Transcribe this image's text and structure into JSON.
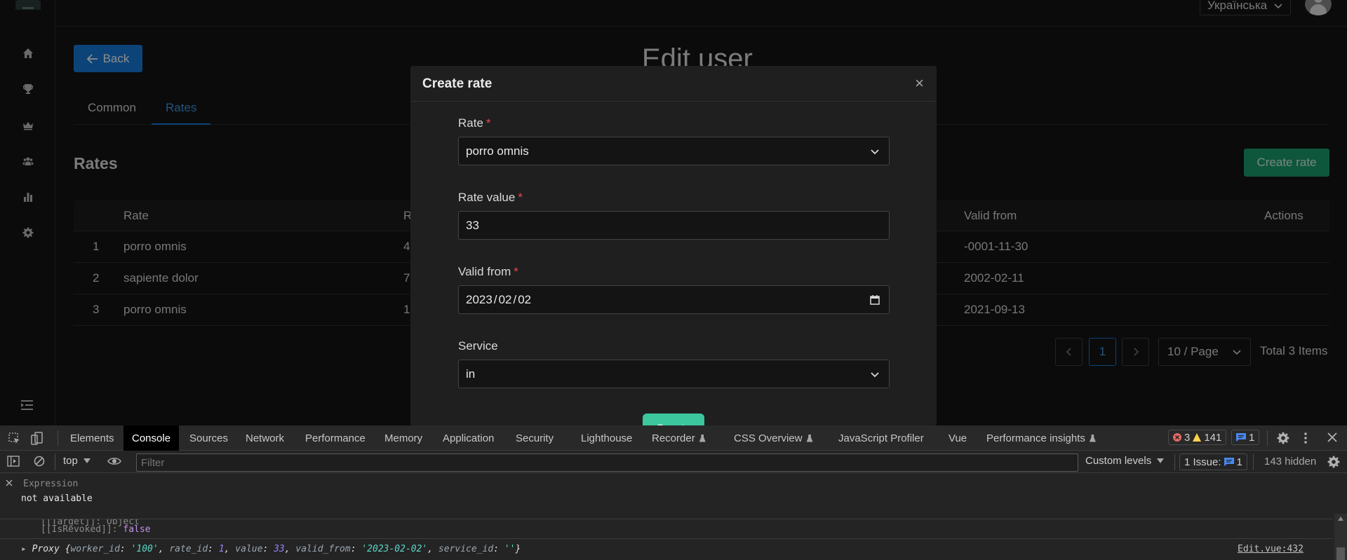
{
  "app": {
    "language": "Українська",
    "back_label": "Back",
    "page_title": "Edit user",
    "tabs": [
      {
        "label": "Common"
      },
      {
        "label": "Rates"
      }
    ],
    "rates_title": "Rates",
    "create_rate_label": "Create rate",
    "table": {
      "headers": {
        "index": "",
        "rate": "Rate",
        "rate_value": "R",
        "valid_from": "Valid from",
        "actions": "Actions"
      },
      "rows": [
        {
          "index": "1",
          "rate": "porro omnis",
          "value": "4",
          "valid_from": "-0001-11-30"
        },
        {
          "index": "2",
          "rate": "sapiente dolor",
          "value": "7",
          "valid_from": "2002-02-11"
        },
        {
          "index": "3",
          "rate": "porro omnis",
          "value": "1",
          "valid_from": "2021-09-13"
        }
      ]
    },
    "pagination": {
      "current_page": "1",
      "page_size": "10 / Page",
      "total": "Total 3 Items"
    }
  },
  "modal": {
    "title": "Create rate",
    "fields": {
      "rate_label": "Rate",
      "rate_value": "porro omnis",
      "rate_value_label": "Rate value",
      "rate_value_value": "33",
      "valid_from_label": "Valid from",
      "valid_from_year": "2023",
      "valid_from_month": "02",
      "valid_from_day": "02",
      "service_label": "Service",
      "service_value": "in",
      "required_mark": "*"
    },
    "create_label": "Create"
  },
  "devtools": {
    "tabs": [
      "Elements",
      "Console",
      "Sources",
      "Network",
      "Performance",
      "Memory",
      "Application",
      "Security",
      "Lighthouse",
      "Recorder",
      "CSS Overview",
      "JavaScript Profiler",
      "Vue",
      "Performance insights"
    ],
    "errors": "3",
    "warnings": "141",
    "messages": "1",
    "context": "top",
    "filter_placeholder": "Filter",
    "levels": "Custom levels",
    "issues_label": "1 Issue:",
    "issues_count": "1",
    "hidden": "143 hidden",
    "expression_label": "Expression",
    "expression_value": "not available",
    "is_revoked_key": "[[IsRevoked]]",
    "is_revoked_value": "false",
    "proxy_line": {
      "prefix": "Proxy {",
      "worker_key": "worker_id",
      "worker_val": "'100'",
      "rate_key": "rate_id",
      "rate_val": "1",
      "value_key": "value",
      "value_val": "33",
      "valid_key": "valid_from",
      "valid_val": "'2023-02-02'",
      "service_key": "service_id",
      "service_val": "''",
      "suffix": "}"
    },
    "source_link": "Edit.vue:432"
  },
  "colors": {
    "primary": "#177ddc",
    "success": "#1a9e6e",
    "create": "#3cc79e",
    "error": "#e84749"
  }
}
